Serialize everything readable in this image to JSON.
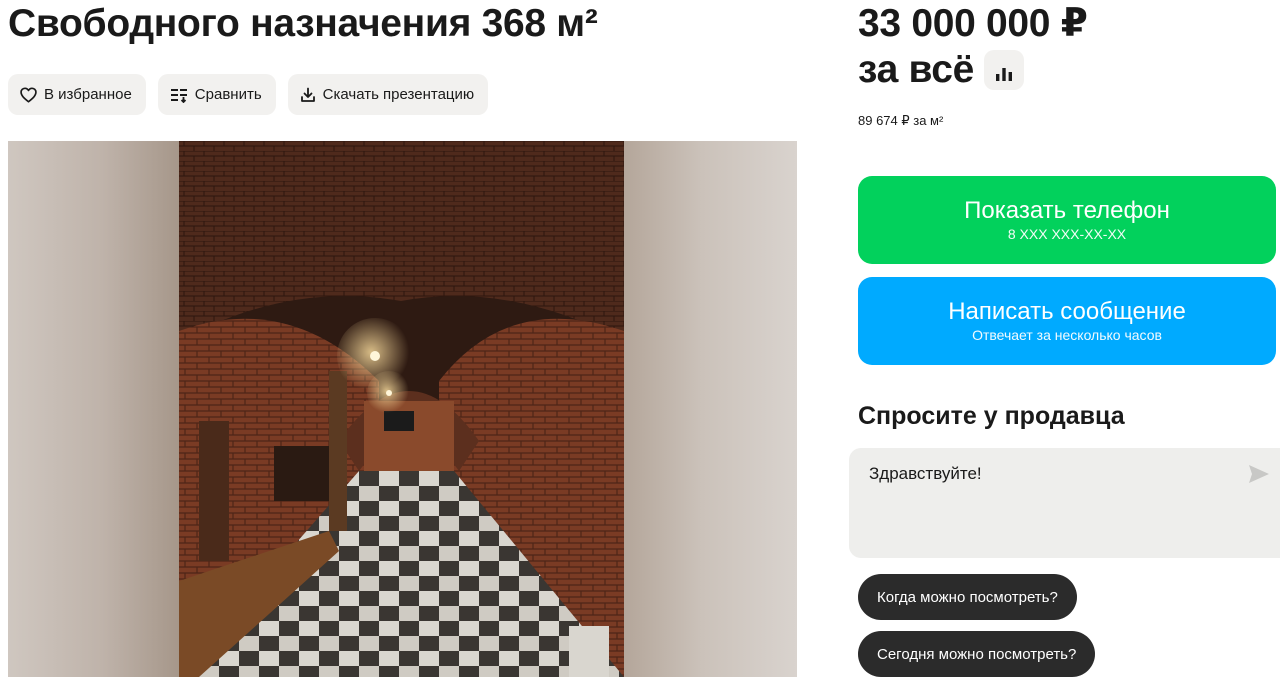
{
  "listing": {
    "title": "Свободного назначения 368 м²",
    "photo_alt": "Фото помещения"
  },
  "actions": [
    {
      "label": "В избранное",
      "icon": "heart-icon"
    },
    {
      "label": "Сравнить",
      "icon": "compare-icon"
    },
    {
      "label": "Скачать презентацию",
      "icon": "download-icon"
    }
  ],
  "price": {
    "amount": "33 000 000 ₽",
    "suffix": "за всё",
    "per_sqm": "89 674 ₽ за м²",
    "history_icon": "bar-chart-icon"
  },
  "contact": {
    "phone_label": "Показать телефон",
    "phone_masked": "8 XXX XXX-XX-XX",
    "message_label": "Написать сообщение",
    "message_note": "Отвечает за несколько часов"
  },
  "ask": {
    "title": "Спросите у продавца",
    "message_value": "Здравствуйте!",
    "send_icon": "send-icon",
    "chips": [
      "Когда можно посмотреть?",
      "Сегодня можно посмотреть?"
    ]
  },
  "colors": {
    "phone_button": "#02d15c",
    "message_button": "#00aaff",
    "chip": "#2b2b2b"
  }
}
